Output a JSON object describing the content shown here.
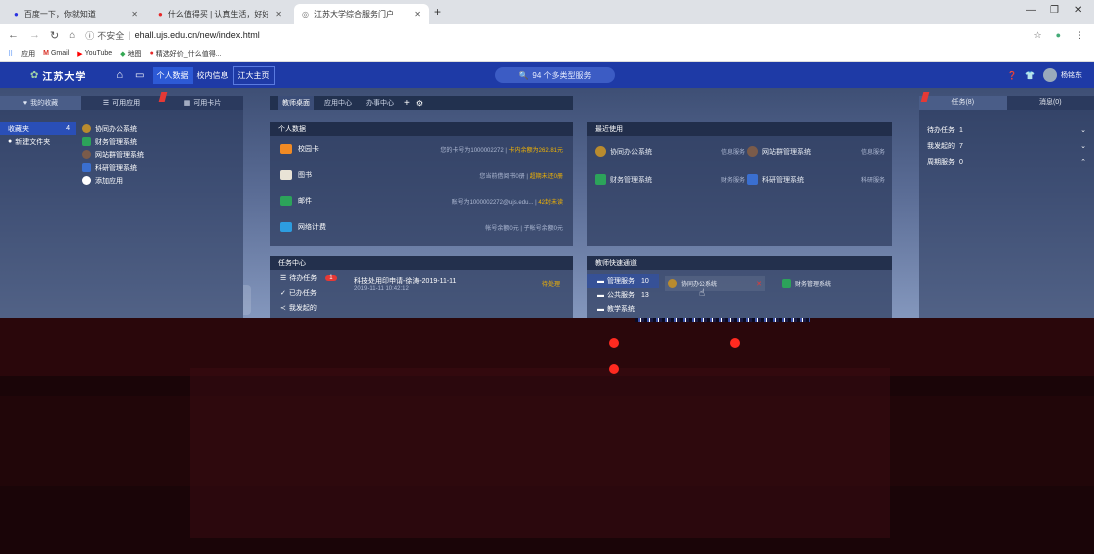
{
  "browser": {
    "tabs": [
      {
        "label": "百度一下，你就知道",
        "active": false
      },
      {
        "label": "什么值得买 | 认真生活，好好花钱",
        "active": false
      },
      {
        "label": "江苏大学综合服务门户",
        "active": true
      }
    ],
    "address": {
      "security": "不安全",
      "url": "ehall.ujs.edu.cn/new/index.html"
    },
    "bookmarks": [
      "应用",
      "Gmail",
      "YouTube",
      "地图",
      "精选好价_什么值得..."
    ]
  },
  "site": {
    "logo": "江苏大学",
    "nav": [
      "个人数据",
      "校内信息",
      "江大主页"
    ],
    "search_placeholder": "94 个多类型服务",
    "user_name": "杨铭东"
  },
  "left_panel": {
    "tabs": [
      "我的收藏",
      "可用应用",
      "可用卡片"
    ],
    "folders": [
      {
        "label": "收藏夹",
        "count": "4"
      },
      {
        "label": "新建文件夹",
        "count": ""
      }
    ],
    "apps": [
      "协同办公系统",
      "财务管理系统",
      "网站群管理系统",
      "科研管理系统",
      "添加应用"
    ]
  },
  "center": {
    "tabs": [
      "教师桌面",
      "应用中心",
      "办事中心"
    ],
    "personal_data": {
      "title": "个人数据",
      "rows": [
        {
          "label": "校园卡",
          "meta": "您的卡号为1000002272 |",
          "highlight": "卡内余额为262.81元"
        },
        {
          "label": "图书",
          "meta": "您当前借阅书0册 |",
          "highlight": "超期未还0册"
        },
        {
          "label": "邮件",
          "meta": "账号为1000002272@ujs.edu... |",
          "highlight": "42封未读"
        },
        {
          "label": "网络计费",
          "meta": "帐号余额0元 | 子帐号余额0元",
          "highlight": ""
        }
      ]
    },
    "task_center": {
      "title": "任务中心",
      "items": [
        {
          "label": "待办任务",
          "badge": "1"
        },
        {
          "label": "已办任务",
          "badge": ""
        },
        {
          "label": "我发起的",
          "badge": ""
        }
      ],
      "task": {
        "title": "科技处用印申请-徐涛-2019-11-11",
        "time": "2019-11-11 10:42:12",
        "status": "待处理"
      }
    }
  },
  "recent": {
    "title": "最近使用",
    "items": [
      {
        "name": "协同办公系统",
        "tag": "信息服务"
      },
      {
        "name": "网站群管理系统",
        "tag": "信息服务"
      },
      {
        "name": "财务管理系统",
        "tag": "财务服务"
      },
      {
        "name": "科研管理系统",
        "tag": "科研服务"
      }
    ]
  },
  "quick_access": {
    "title": "教师快速通道",
    "categories": [
      {
        "label": "管理服务",
        "count": "10"
      },
      {
        "label": "公共服务",
        "count": "13"
      },
      {
        "label": "教学系统",
        "count": ""
      }
    ],
    "apps": [
      "协同办公系统",
      "财务管理系统"
    ]
  },
  "right_panel": {
    "tabs": [
      "任务(8)",
      "消息(0)"
    ],
    "rows": [
      {
        "label": "待办任务",
        "count": "1"
      },
      {
        "label": "我发起的",
        "count": "7"
      },
      {
        "label": "周期服务",
        "count": "0"
      }
    ]
  },
  "colors": {
    "header": "#1e3aa6",
    "accent": "#2a4fb7",
    "highlight": "#f4b400",
    "glitch_red": "#ff2a20"
  }
}
